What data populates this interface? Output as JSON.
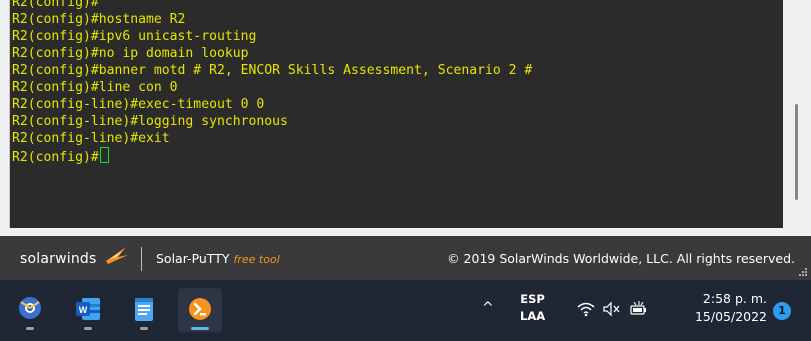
{
  "terminal": {
    "lines": [
      "R2(config)#",
      "R2(config)#hostname R2",
      "R2(config)#ipv6 unicast-routing",
      "R2(config)#no ip domain lookup",
      "R2(config)#banner motd # R2, ENCOR Skills Assessment, Scenario 2 #",
      "R2(config)#line con 0",
      "R2(config-line)#exec-timeout 0 0",
      "R2(config-line)#logging synchronous",
      "R2(config-line)#exit",
      "R2(config)#"
    ],
    "text_color": "#e6e600",
    "cursor_color": "#23d923",
    "background": "#2b2b2b"
  },
  "footer": {
    "brand": "solarwinds",
    "product": "Solar-PuTTY",
    "product_tag": "free tool",
    "copyright": "© 2019 SolarWinds Worldwide, LLC. All rights reserved.",
    "accent": "#f7931e"
  },
  "taskbar": {
    "apps": [
      {
        "name": "chrome-canary",
        "icon": "globe-app-icon"
      },
      {
        "name": "word",
        "icon": "word-icon",
        "label": "W"
      },
      {
        "name": "notepad",
        "icon": "notepad-icon"
      },
      {
        "name": "solar-putty",
        "icon": "terminal-app-icon"
      }
    ],
    "chevron": "^",
    "language": "ESP",
    "keyboard": "LAA",
    "time": "2:58 p. m.",
    "date": "15/05/2022",
    "notification_count": "1"
  }
}
